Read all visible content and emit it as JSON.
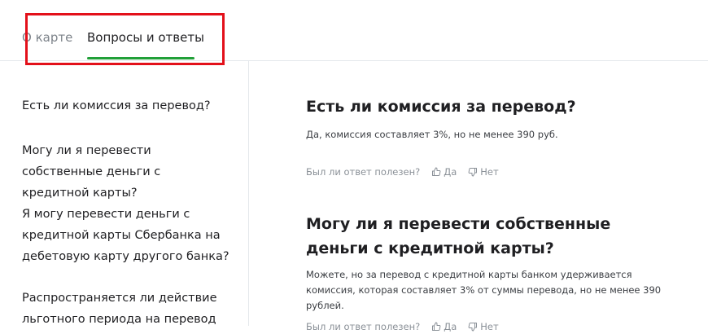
{
  "tabs": {
    "about_label": "О карте",
    "faq_label": "Вопросы и ответы"
  },
  "sidebar": {
    "items": [
      {
        "label": "Есть ли комиссия за перевод?"
      },
      {
        "label": "Могу ли я перевести собственные деньги с кредитной карты?"
      },
      {
        "label": "Я могу перевести деньги с кредитной карты Сбербанка на дебетовую карту другого банка?"
      },
      {
        "label": "Распространяется ли действие льготного периода на перевод"
      }
    ]
  },
  "faq": {
    "items": [
      {
        "question": "Есть ли комиссия за перевод?",
        "answer": "Да, комиссия составляет 3%, но не менее 390 руб."
      },
      {
        "question": "Могу ли я перевести собственные деньги с кредитной карты?",
        "answer": "Можете, но за перевод с кредитной карты банком удерживается комиссия, которая составляет 3% от суммы перевода, но не менее 390 рублей."
      }
    ],
    "feedback_prompt": "Был ли ответ полезен?",
    "yes_label": "Да",
    "no_label": "Нет"
  },
  "colors": {
    "accent_underline": "#21a038",
    "highlight_box": "#e3101a"
  },
  "icons": {
    "yes": "thumbs-up-icon",
    "no": "thumbs-down-icon"
  }
}
